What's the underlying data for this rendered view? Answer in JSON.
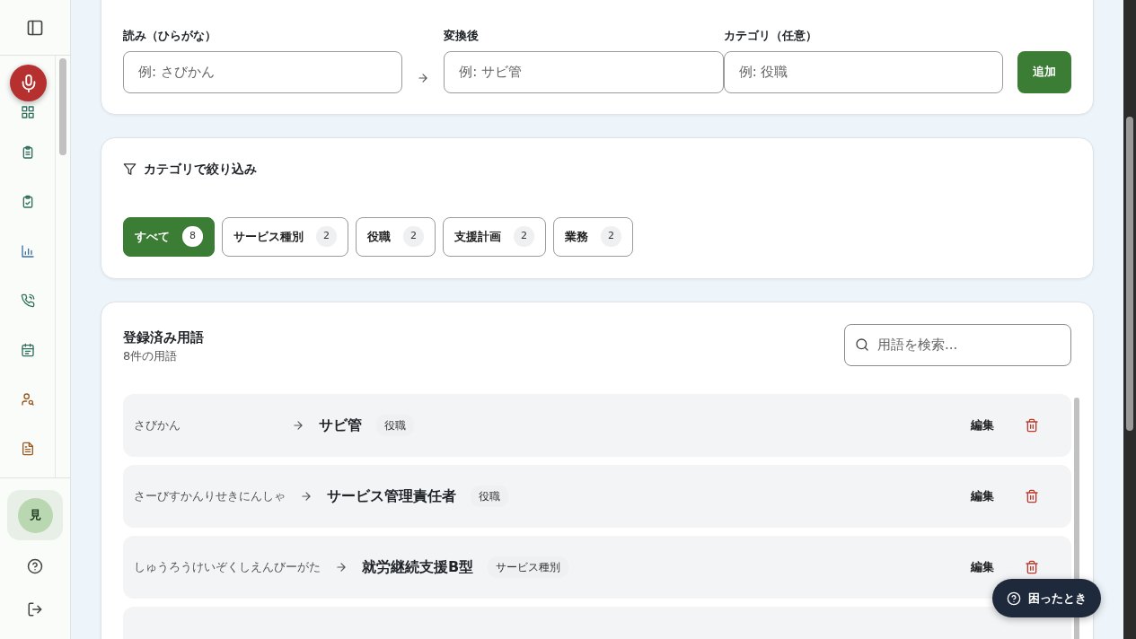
{
  "sidebar": {
    "avatar": "見"
  },
  "add_form": {
    "fields": [
      {
        "label": "読み（ひらがな）",
        "placeholder": "例: さびかん"
      },
      {
        "label": "変換後",
        "placeholder": "例: サビ管"
      },
      {
        "label": "カテゴリ（任意）",
        "placeholder": "例: 役職"
      }
    ],
    "button": "追加"
  },
  "filter": {
    "title": "カテゴリで絞り込み",
    "chips": [
      {
        "label": "すべて",
        "count": "8",
        "selected": true
      },
      {
        "label": "サービス種別",
        "count": "2",
        "selected": false
      },
      {
        "label": "役職",
        "count": "2",
        "selected": false
      },
      {
        "label": "支援計画",
        "count": "2",
        "selected": false
      },
      {
        "label": "業務",
        "count": "2",
        "selected": false
      }
    ]
  },
  "terms": {
    "title": "登録済み用語",
    "subtitle": "8件の用語",
    "search_placeholder": "用語を検索...",
    "rows": [
      {
        "reading": "さびかん",
        "term": "サビ管",
        "category": "役職",
        "edit": "編集"
      },
      {
        "reading": "さーびすかんりせきにんしゃ",
        "term": "サービス管理責任者",
        "category": "役職",
        "edit": "編集"
      },
      {
        "reading": "しゅうろうけいぞくしえんびーがた",
        "term": "就労継続支援B型",
        "category": "サービス種別",
        "edit": "編集"
      }
    ]
  },
  "help_button": "困ったとき"
}
